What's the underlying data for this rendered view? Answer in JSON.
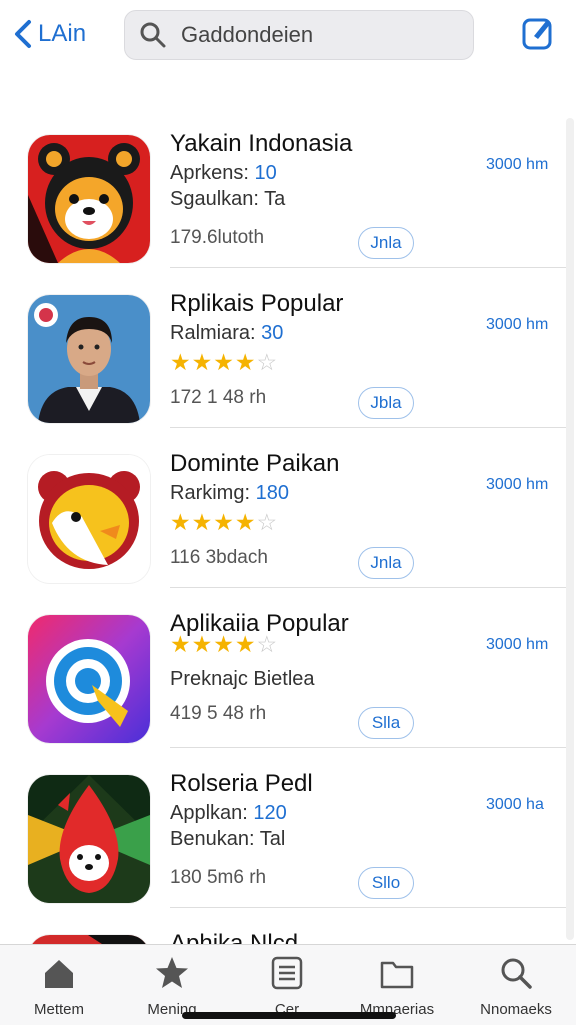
{
  "header": {
    "back_label": "LAin",
    "search_text": "Gaddondeien",
    "icon_edit": "edit-icon"
  },
  "apps": [
    {
      "title": "Yakain Indonasia",
      "line1_label": "Aprkens:",
      "line1_num": "10",
      "line2": "Sgaulkan: Ta",
      "line3": "179.6lutoth",
      "distance": "3000 hm",
      "button": "Jnla",
      "rating": null,
      "icon": "hamster-icon"
    },
    {
      "title": "Rplikais Popular",
      "line1_label": "Ralmiara:",
      "line1_num": "30",
      "line2": "",
      "line3": "172 1 48 rh",
      "distance": "3000 hm",
      "button": "Jbla",
      "rating": 4,
      "icon": "portrait-icon"
    },
    {
      "title": "Dominte Paikan",
      "line1_label": "Rarkimg:",
      "line1_num": "180",
      "line2": "",
      "line3": "116 3bdach",
      "distance": "3000 hm",
      "button": "Jnla",
      "rating": 4,
      "icon": "bear-icon"
    },
    {
      "title": "Aplikaiia Popular",
      "line1_label": "",
      "line1_num": "",
      "line2": "Preknajc Bietlea",
      "line3": "419 5 48 rh",
      "distance": "3000 hm",
      "button": "Slla",
      "rating": 4,
      "icon": "target-icon"
    },
    {
      "title": "Rolseria Pedl",
      "line1_label": "Applkan:",
      "line1_num": "120",
      "line2": "Benukan: Tal",
      "line3": "180 5m6 rh",
      "distance": "3000 ha",
      "button": "Sllo",
      "rating": null,
      "icon": "fox-icon"
    },
    {
      "title": "Aphika Nlcd",
      "line1_label": "",
      "line1_num": "",
      "line2": "",
      "line3": "",
      "distance": "",
      "button": "",
      "rating": null,
      "icon": "app-icon"
    }
  ],
  "tabs": [
    {
      "label": "Mettem",
      "icon": "home-icon"
    },
    {
      "label": "Mening",
      "icon": "star-icon"
    },
    {
      "label": "Cer",
      "icon": "list-icon"
    },
    {
      "label": "Mmnaerias",
      "icon": "folder-icon"
    },
    {
      "label": "Nnomaeks",
      "icon": "search-icon"
    }
  ],
  "colors": {
    "accent": "#1f6fd1",
    "star": "#f5b301"
  }
}
